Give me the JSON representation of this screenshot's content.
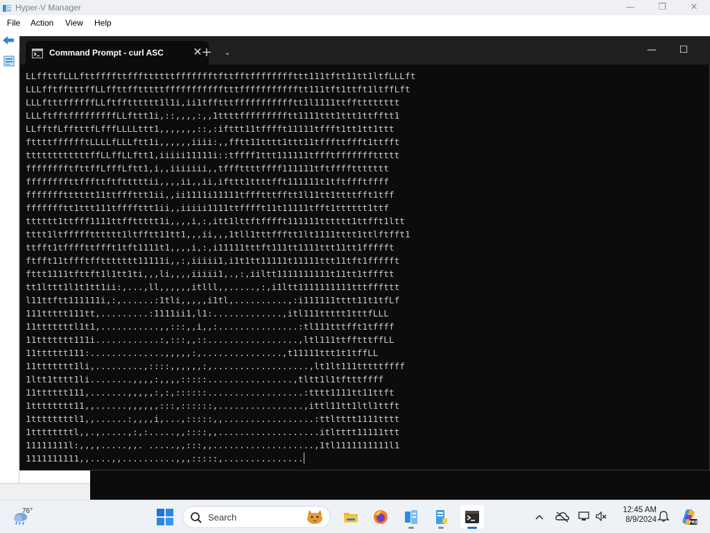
{
  "hyperv": {
    "title": "Hyper-V Manager",
    "menu": [
      "File",
      "Action",
      "View",
      "Help"
    ]
  },
  "terminal": {
    "tab_title": "Command Prompt - curl  ASC",
    "lines": [
      "LLffttfLLLfttffffttfffttttttffffffftfttfftffffffffttt111tftt11tt1ltfLLLft",
      "LLLfftfftttffLLffttfftttttffffffffffftttffffffffffftt111tft1ttft1ltffLft",
      "LLLftttffffffLLftfftttttt1l1i,ii1tfftttffffffffffftt1l1111ttfftttttttt",
      "LLLftfftfffffffffLLfttt1i,::,,,,:,,1ttttffffffffftt1111ttt1ttt1ttfftt1",
      "LLfftfLfftttfLfffLLLLttt1,,,,,,,::,:ifttt11tfffft11111tffft1tt1tt1ttt",
      "fttttfffffftLLLLfLLLftt1i,,,,,,iiii:,,fftt11tttt1ttt11tfffttffft1ttfft",
      "ttttttttttttffLLffLLftt1,iiiii11111i::tffff1ttt111111tffftfffffffttttt",
      "fffffffftfttffLfffLftt1,i,,iiiiiii,,tfffttttffff111111tftffffttttttt",
      "ffffffffttfffttftftttttii,,,,ii,,ii,ifttt1ttttfft111111t1tftffftffff",
      "ffffffftttttt11ttfffttt1ii,,ii1111i11111tffftttfftt1l11tt1ttttfft1tff",
      "ffffffftt1ttt111tffffttt1ii,,iiiii1111ttfffft11t11111tfft1tttttt1ttf",
      "tttttt1ttfff1111ttffttttt1i,,,,i,:,itt1lttftfffft111111tttttt1ttfft1ltt",
      "tttt1ltffffftttttt1ltfftt11tt1,,,ii,,,1tll1tttffftt1lt1111tttt1ttlftfft1",
      "ttfft1tffffttffft1tft1111t1,,,,i,:,i11111tttft111tt1111ttt11tt1ffffft",
      "ftfft11tffftffttttttt11111i,,:,iiiii1,i1t1tt11111t11111ttt11tft1ffffft",
      "fttt1111tfttft1l1tt1ti,,,li,,,,iiiii1,.,:,iiltt1111111111t11tt1tffftt",
      "tt1lttt1l1t1tt1ii:,...,ll,,,,,,itlll,,.....,:,i1ltt1111111111tttfffttt",
      "l11ttftt111111i,:,......:1tli,,,,,i1tl,..........,:i111111tttt11t1tfLf",
      "111ttttt111tt,.........:1111ii1,l1:.............,itl111ttttt1tttfLLL",
      "11tttttttl1t1,...........,,:::,,i,,:...............:tl111tttfft1tffff",
      "11ttttttt111i............:,:::,,::.................,ltl111ttfftttffLL",
      "11tttttt111:..............,,,,,:,...............,t11111ttt1t1tffLL",
      "11ttttttt1li,.........,::::,,,,,,:,..................,lt1lt111tttttffff",
      "1ltt1tttt1li........,,,,:,,,,:::::................,tltt1l1tftttffff",
      "11tttttt111,.......,,,,,:,:,::::::..................:tttt1111tt11ttft",
      "1tttttttt11,,......,,,,,,:::,::::::,................,ittl11tt1ltl1ttft",
      "1ttttttttl1,,......:,,,,i,...,:::::,,.................:ttltttt1111tttt",
      "1ttttttttl,,.,.....,:,:.....,,::::,,...................itltttt11111ttt",
      "11111111l:,,,,.....,,. .....,,:::,,...................,1tl1111111111l1",
      "1111111111,,....,,..........,,,:::::,..............."
    ]
  },
  "taskbar": {
    "weather_temp": "76°",
    "search_placeholder": "Search",
    "time": "12:45 AM",
    "date": "8/9/2024"
  }
}
